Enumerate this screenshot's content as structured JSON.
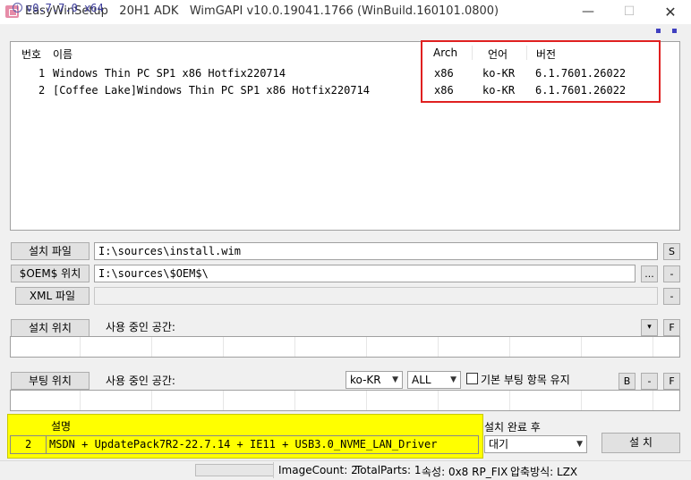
{
  "window": {
    "title": "EasyWinSetup   20H1 ADK   WimGAPI v10.0.19041.1766 (WinBuild.160101.0800)",
    "minimize": "—",
    "maximize": "☐",
    "close": "✕"
  },
  "version": {
    "label": "v0.7.7.0 x64",
    "info_icon": "i"
  },
  "image_list": {
    "columns": [
      "번호",
      "이름",
      "Arch",
      "언어",
      "버전"
    ],
    "rows": [
      {
        "index": "1",
        "name": "Windows Thin PC SP1 x86 Hotfix220714",
        "arch": "x86",
        "lang": "ko-KR",
        "version": "6.1.7601.26022"
      },
      {
        "index": "2",
        "name": "[Coffee Lake]Windows Thin PC SP1 x86 Hotfix220714",
        "arch": "x86",
        "lang": "ko-KR",
        "version": "6.1.7601.26022"
      }
    ],
    "highlight_color": "#e02020"
  },
  "install_file": {
    "button": "설치 파일",
    "value": "I:\\sources\\install.wim",
    "side_button": "S"
  },
  "oem_location": {
    "button": "$OEM$ 위치",
    "value": "I:\\sources\\$OEM$\\",
    "browse": "...",
    "minus": "-"
  },
  "xml_file": {
    "button": "XML 파일",
    "value": "",
    "minus": "-"
  },
  "install_location": {
    "button": "설치 위치",
    "space_label": "사용 중인 공간:",
    "dropdown": "▾",
    "f_button": "F"
  },
  "boot_location": {
    "button": "부팅 위치",
    "space_label": "사용 중인 공간:",
    "language": "ko-KR",
    "scope": "ALL",
    "keep_checkbox_label": "기본 부팅 항목 유지",
    "keep_checked": false,
    "b_button": "B",
    "minus": "-",
    "f_button": "F"
  },
  "description": {
    "header": "설명",
    "index": "2",
    "text": "MSDN + UpdatePack7R2-22.7.14 + IE11 + USB3.0_NVME_LAN_Driver",
    "highlight_color": "#ffff00"
  },
  "after_install": {
    "label": "설치 완료 후",
    "value": "대기"
  },
  "install_button": "설 치",
  "status": {
    "image_count": "ImageCount: 2",
    "total_parts": "TotalParts: 1",
    "attribute": "속성: 0x8 RP_FIX",
    "compression": "압축방식: LZX"
  }
}
